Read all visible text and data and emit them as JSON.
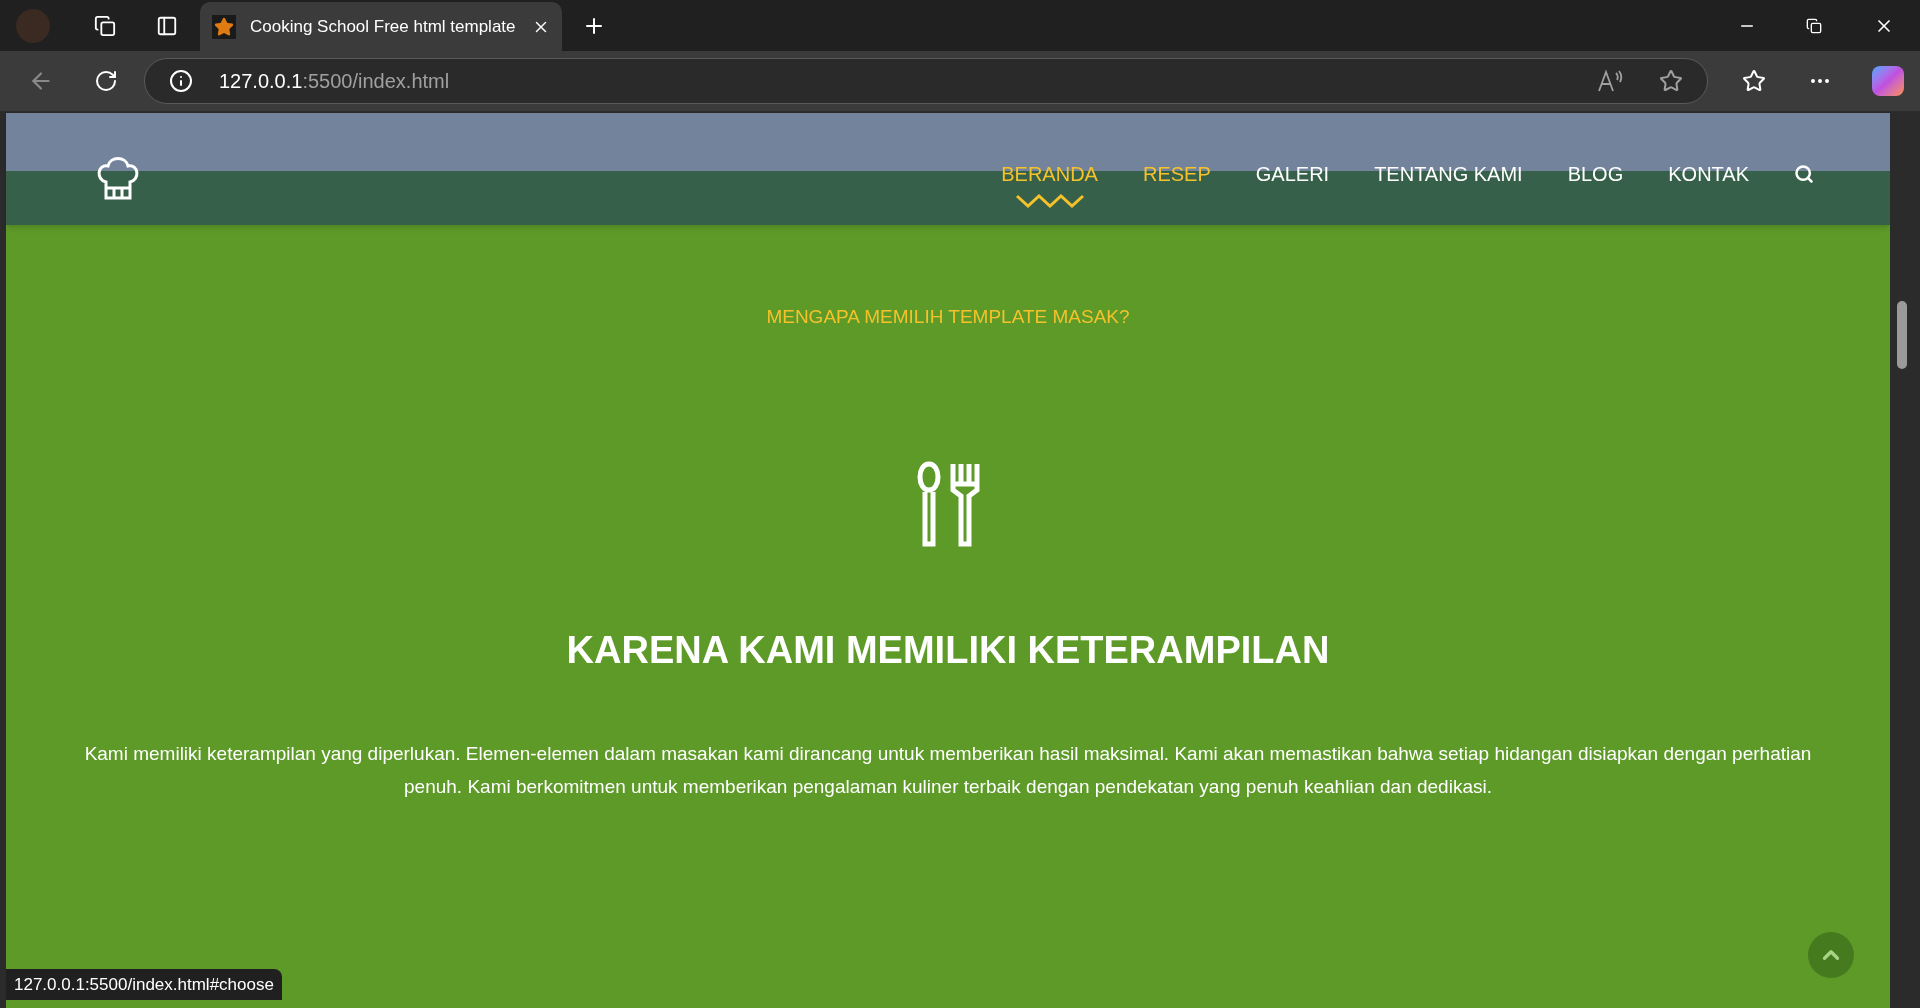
{
  "browser": {
    "tab_title": "Cooking School Free html template",
    "url_host": "127.0.0.1",
    "url_path": ":5500/index.html",
    "status_url": "127.0.0.1:5500/index.html#choose"
  },
  "nav": [
    {
      "label": "BERANDA",
      "selected": true,
      "highlighted": true
    },
    {
      "label": "RESEP",
      "selected": false,
      "highlighted": true
    },
    {
      "label": "GALERI",
      "selected": false,
      "highlighted": false
    },
    {
      "label": "TENTANG KAMI",
      "selected": false,
      "highlighted": false
    },
    {
      "label": "BLOG",
      "selected": false,
      "highlighted": false
    },
    {
      "label": "KONTAK",
      "selected": false,
      "highlighted": false
    }
  ],
  "section": {
    "eyebrow": "MENGAPA MEMILIH TEMPLATE MASAK?",
    "title": "KARENA KAMI MEMILIKI KETERAMPILAN",
    "body": "Kami memiliki keterampilan yang diperlukan. Elemen-elemen dalam masakan kami dirancang untuk memberikan hasil maksimal. Kami akan memastikan bahwa setiap hidangan disiapkan dengan perhatian penuh. Kami berkomitmen untuk memberikan pengalaman kuliner terbaik dengan pendekatan yang penuh keahlian dan dedikasi."
  }
}
